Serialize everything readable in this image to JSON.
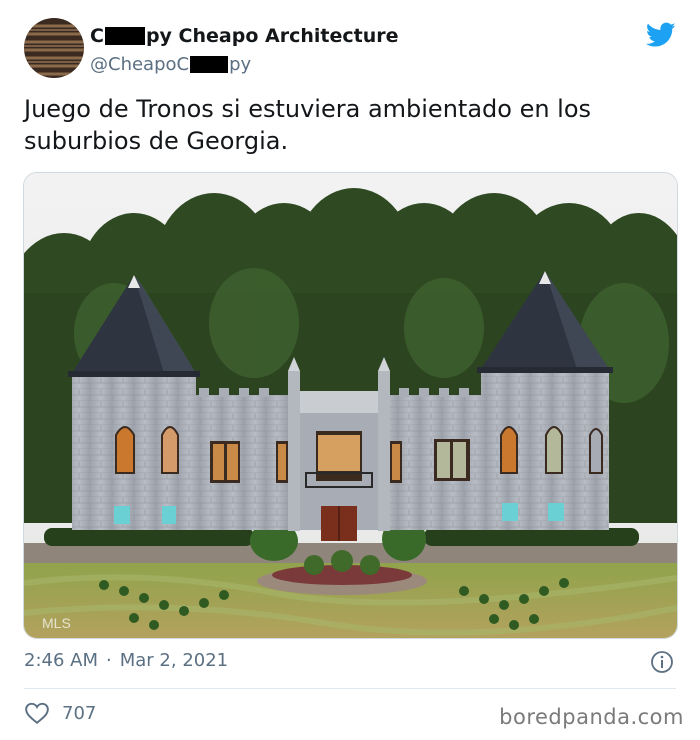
{
  "author": {
    "name_first": "C",
    "name_rest": "py Cheapo Architecture",
    "handle_first": "@CheapoC",
    "handle_rest": "py"
  },
  "tweet": {
    "text": "Juego de Tronos si estuviera ambientado en los suburbios de Georgia.",
    "time": "2:46 AM",
    "separator": "·",
    "date": "Mar 2, 2021",
    "likes": "707"
  },
  "photo": {
    "watermark": "MLS"
  },
  "credit": "boredpanda.com",
  "colors": {
    "twitter_blue": "#1da1f2",
    "meta_gray": "#5b7083"
  },
  "icons": [
    "twitter-bird-icon",
    "info-icon",
    "heart-icon"
  ]
}
